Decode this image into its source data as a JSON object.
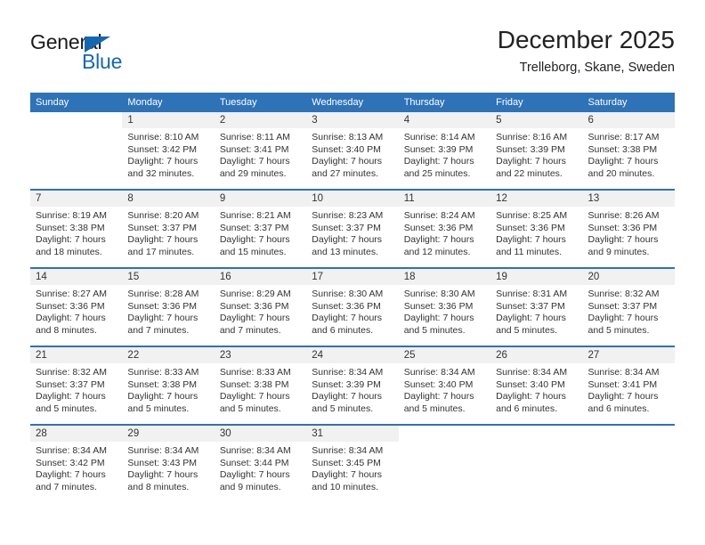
{
  "logo": {
    "word_top": "General",
    "word_bottom": "Blue",
    "triangle_color": "#1567b2",
    "text_color": "#1b1b1b"
  },
  "header": {
    "title": "December 2025",
    "subtitle": "Trelleborg, Skane, Sweden"
  },
  "theme": {
    "header_blue": "#2e72b8",
    "daynum_gray": "#f1f1f1",
    "text": "#333333"
  },
  "calendar": {
    "weekday_headers": [
      "Sunday",
      "Monday",
      "Tuesday",
      "Wednesday",
      "Thursday",
      "Friday",
      "Saturday"
    ],
    "weeks": [
      [
        {
          "day": "",
          "blank": true,
          "lines": []
        },
        {
          "day": "1",
          "lines": [
            "Sunrise: 8:10 AM",
            "Sunset: 3:42 PM",
            "Daylight: 7 hours",
            "and 32 minutes."
          ]
        },
        {
          "day": "2",
          "lines": [
            "Sunrise: 8:11 AM",
            "Sunset: 3:41 PM",
            "Daylight: 7 hours",
            "and 29 minutes."
          ]
        },
        {
          "day": "3",
          "lines": [
            "Sunrise: 8:13 AM",
            "Sunset: 3:40 PM",
            "Daylight: 7 hours",
            "and 27 minutes."
          ]
        },
        {
          "day": "4",
          "lines": [
            "Sunrise: 8:14 AM",
            "Sunset: 3:39 PM",
            "Daylight: 7 hours",
            "and 25 minutes."
          ]
        },
        {
          "day": "5",
          "lines": [
            "Sunrise: 8:16 AM",
            "Sunset: 3:39 PM",
            "Daylight: 7 hours",
            "and 22 minutes."
          ]
        },
        {
          "day": "6",
          "lines": [
            "Sunrise: 8:17 AM",
            "Sunset: 3:38 PM",
            "Daylight: 7 hours",
            "and 20 minutes."
          ]
        }
      ],
      [
        {
          "day": "7",
          "lines": [
            "Sunrise: 8:19 AM",
            "Sunset: 3:38 PM",
            "Daylight: 7 hours",
            "and 18 minutes."
          ]
        },
        {
          "day": "8",
          "lines": [
            "Sunrise: 8:20 AM",
            "Sunset: 3:37 PM",
            "Daylight: 7 hours",
            "and 17 minutes."
          ]
        },
        {
          "day": "9",
          "lines": [
            "Sunrise: 8:21 AM",
            "Sunset: 3:37 PM",
            "Daylight: 7 hours",
            "and 15 minutes."
          ]
        },
        {
          "day": "10",
          "lines": [
            "Sunrise: 8:23 AM",
            "Sunset: 3:37 PM",
            "Daylight: 7 hours",
            "and 13 minutes."
          ]
        },
        {
          "day": "11",
          "lines": [
            "Sunrise: 8:24 AM",
            "Sunset: 3:36 PM",
            "Daylight: 7 hours",
            "and 12 minutes."
          ]
        },
        {
          "day": "12",
          "lines": [
            "Sunrise: 8:25 AM",
            "Sunset: 3:36 PM",
            "Daylight: 7 hours",
            "and 11 minutes."
          ]
        },
        {
          "day": "13",
          "lines": [
            "Sunrise: 8:26 AM",
            "Sunset: 3:36 PM",
            "Daylight: 7 hours",
            "and 9 minutes."
          ]
        }
      ],
      [
        {
          "day": "14",
          "lines": [
            "Sunrise: 8:27 AM",
            "Sunset: 3:36 PM",
            "Daylight: 7 hours",
            "and 8 minutes."
          ]
        },
        {
          "day": "15",
          "lines": [
            "Sunrise: 8:28 AM",
            "Sunset: 3:36 PM",
            "Daylight: 7 hours",
            "and 7 minutes."
          ]
        },
        {
          "day": "16",
          "lines": [
            "Sunrise: 8:29 AM",
            "Sunset: 3:36 PM",
            "Daylight: 7 hours",
            "and 7 minutes."
          ]
        },
        {
          "day": "17",
          "lines": [
            "Sunrise: 8:30 AM",
            "Sunset: 3:36 PM",
            "Daylight: 7 hours",
            "and 6 minutes."
          ]
        },
        {
          "day": "18",
          "lines": [
            "Sunrise: 8:30 AM",
            "Sunset: 3:36 PM",
            "Daylight: 7 hours",
            "and 5 minutes."
          ]
        },
        {
          "day": "19",
          "lines": [
            "Sunrise: 8:31 AM",
            "Sunset: 3:37 PM",
            "Daylight: 7 hours",
            "and 5 minutes."
          ]
        },
        {
          "day": "20",
          "lines": [
            "Sunrise: 8:32 AM",
            "Sunset: 3:37 PM",
            "Daylight: 7 hours",
            "and 5 minutes."
          ]
        }
      ],
      [
        {
          "day": "21",
          "lines": [
            "Sunrise: 8:32 AM",
            "Sunset: 3:37 PM",
            "Daylight: 7 hours",
            "and 5 minutes."
          ]
        },
        {
          "day": "22",
          "lines": [
            "Sunrise: 8:33 AM",
            "Sunset: 3:38 PM",
            "Daylight: 7 hours",
            "and 5 minutes."
          ]
        },
        {
          "day": "23",
          "lines": [
            "Sunrise: 8:33 AM",
            "Sunset: 3:38 PM",
            "Daylight: 7 hours",
            "and 5 minutes."
          ]
        },
        {
          "day": "24",
          "lines": [
            "Sunrise: 8:34 AM",
            "Sunset: 3:39 PM",
            "Daylight: 7 hours",
            "and 5 minutes."
          ]
        },
        {
          "day": "25",
          "lines": [
            "Sunrise: 8:34 AM",
            "Sunset: 3:40 PM",
            "Daylight: 7 hours",
            "and 5 minutes."
          ]
        },
        {
          "day": "26",
          "lines": [
            "Sunrise: 8:34 AM",
            "Sunset: 3:40 PM",
            "Daylight: 7 hours",
            "and 6 minutes."
          ]
        },
        {
          "day": "27",
          "lines": [
            "Sunrise: 8:34 AM",
            "Sunset: 3:41 PM",
            "Daylight: 7 hours",
            "and 6 minutes."
          ]
        }
      ],
      [
        {
          "day": "28",
          "lines": [
            "Sunrise: 8:34 AM",
            "Sunset: 3:42 PM",
            "Daylight: 7 hours",
            "and 7 minutes."
          ]
        },
        {
          "day": "29",
          "lines": [
            "Sunrise: 8:34 AM",
            "Sunset: 3:43 PM",
            "Daylight: 7 hours",
            "and 8 minutes."
          ]
        },
        {
          "day": "30",
          "lines": [
            "Sunrise: 8:34 AM",
            "Sunset: 3:44 PM",
            "Daylight: 7 hours",
            "and 9 minutes."
          ]
        },
        {
          "day": "31",
          "lines": [
            "Sunrise: 8:34 AM",
            "Sunset: 3:45 PM",
            "Daylight: 7 hours",
            "and 10 minutes."
          ]
        },
        {
          "day": "",
          "blank": true,
          "lines": []
        },
        {
          "day": "",
          "blank": true,
          "lines": []
        },
        {
          "day": "",
          "blank": true,
          "lines": []
        }
      ]
    ]
  }
}
